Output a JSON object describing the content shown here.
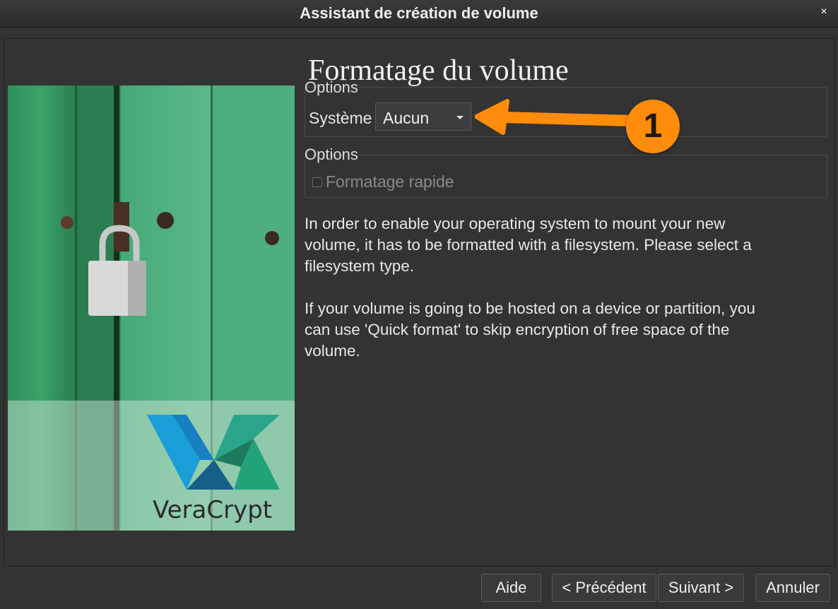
{
  "window": {
    "title": "Assistant de création de volume",
    "close_glyph": "×"
  },
  "page": {
    "title": "Formatage du volume"
  },
  "filesystem_group": {
    "label": "Options",
    "field_label": "Système",
    "selected": "Aucun"
  },
  "options_group": {
    "label": "Options",
    "quick_format_label": "Formatage rapide",
    "quick_format_checked": false,
    "quick_format_enabled": false
  },
  "description": {
    "paragraph1": "In order to enable your operating system to mount your new volume, it has to be formatted with a filesystem. Please select a filesystem type.",
    "paragraph2": "If your volume is going to be hosted on a device or partition, you can use 'Quick format' to skip encryption of free space of the volume."
  },
  "image": {
    "brand_text": "VeraCrypt",
    "icon": "padlock-on-green-door"
  },
  "annotation": {
    "number": "1",
    "color": "#ff8c0a"
  },
  "buttons": {
    "help": "Aide",
    "previous": "< Précédent",
    "next": "Suivant >",
    "cancel": "Annuler"
  }
}
